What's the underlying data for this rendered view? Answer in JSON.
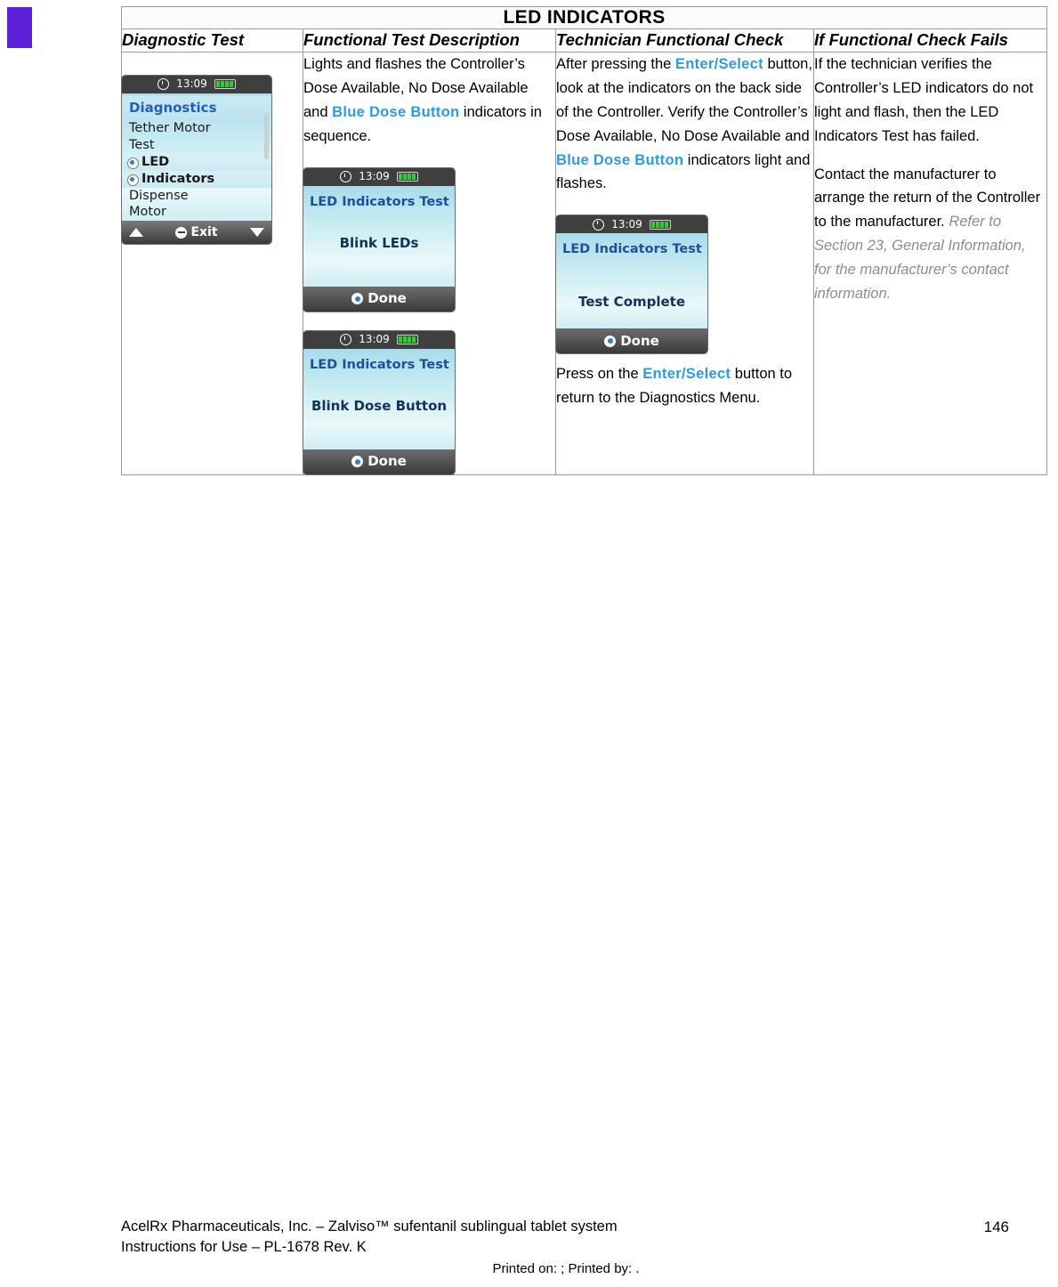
{
  "document": {
    "table_title": "LED INDICATORS",
    "headers": {
      "col1": "Diagnostic Test",
      "col2": "Functional Test Description",
      "col3": "Technician Functional Check",
      "col4": "If Functional Check Fails"
    },
    "col2": {
      "p1_a": "Lights and flashes the Controller’s Dose Available, No Dose Available and ",
      "p1_blue": "Blue Dose Button",
      "p1_b": " indicators in sequence."
    },
    "col3": {
      "p1_a": "After pressing the ",
      "p1_blue": "Enter/Select",
      "p1_b": " button, look at the indicators on the back side of the Controller.  Verify the Controller’s Dose Available, No Dose Available and ",
      "p1_blue2": "Blue Dose Button",
      "p1_c": " indicators light and flashes.",
      "p2_a": "Press on the ",
      "p2_blue": "Enter/Select",
      "p2_b": " button to return to the Diagnostics Menu."
    },
    "col4": {
      "p1": "If the technician verifies the Controller’s LED indicators do not light and flash, then the LED Indicators Test has failed.",
      "p2_a": "Contact the manufacturer to arrange the return of the Controller to the manufacturer.  ",
      "p2_italic": "Refer to Section 23, General Information, for the manufacturer’s contact information."
    }
  },
  "devices": {
    "diagnostics_menu": {
      "time": "13:09",
      "title": "Diagnostics",
      "items": [
        "Tether Motor",
        "Test",
        "LED",
        "Indicators",
        "Dispense",
        "Motor"
      ],
      "exit_label": "Exit"
    },
    "blink_leds": {
      "time": "13:09",
      "title": "LED Indicators Test",
      "message": "Blink LEDs",
      "button": "Done"
    },
    "blink_dose_button": {
      "time": "13:09",
      "title": "LED Indicators Test",
      "message": "Blink Dose Button",
      "button": "Done"
    },
    "test_complete": {
      "time": "13:09",
      "title": "LED Indicators Test",
      "message": "Test Complete",
      "button": "Done"
    }
  },
  "footer": {
    "line1": "AcelRx Pharmaceuticals, Inc. – Zalviso™ sufentanil sublingual tablet system",
    "line2": "Instructions for Use – PL-1678 Rev. K",
    "page_number": "146",
    "printed": "Printed on: ; Printed by: ."
  }
}
